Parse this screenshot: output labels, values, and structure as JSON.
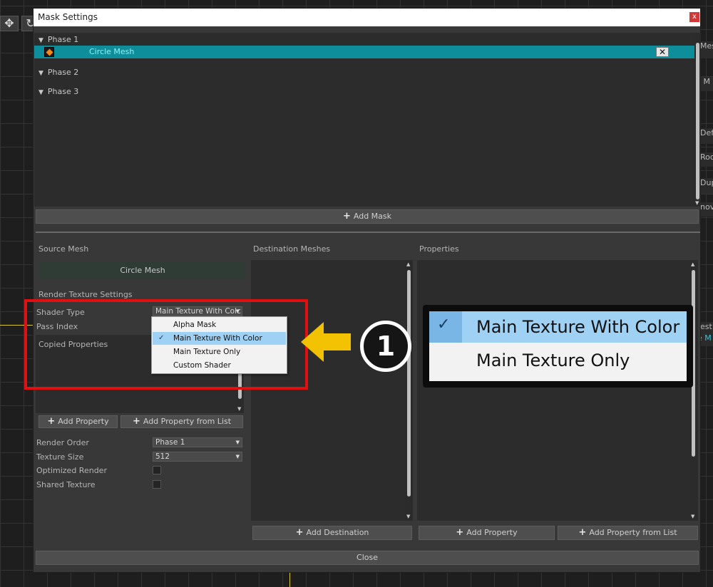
{
  "background": {
    "right_labels": [
      "Mes",
      "M",
      "Def",
      "Roo",
      "Dup",
      "nove",
      "est",
      "e M"
    ]
  },
  "dialog": {
    "title": "Mask Settings",
    "close_glyph": "x",
    "phases": [
      {
        "label": "Phase 1"
      },
      {
        "label": "Phase 2"
      },
      {
        "label": "Phase 3"
      }
    ],
    "mask_item": {
      "name": "Circle Mesh",
      "delete_glyph": "✕"
    },
    "add_mask_label": "Add Mask",
    "source": {
      "header": "Source Mesh",
      "mesh_name": "Circle Mesh",
      "render_texture_header": "Render Texture Settings",
      "shader_type_label": "Shader Type",
      "shader_type_value": "Main Texture With Colc",
      "pass_index_label": "Pass Index",
      "copied_properties_label": "Copied Properties",
      "add_property_label": "Add Property",
      "add_property_from_list_label": "Add Property from List",
      "render_order_label": "Render Order",
      "render_order_value": "Phase 1",
      "texture_size_label": "Texture Size",
      "texture_size_value": "512",
      "optimized_render_label": "Optimized Render",
      "shared_texture_label": "Shared Texture"
    },
    "destination": {
      "header": "Destination Meshes",
      "add_label": "Add Destination"
    },
    "properties": {
      "header": "Properties",
      "add_label": "Add Property",
      "add_from_list_label": "Add Property from List"
    },
    "close_label": "Close"
  },
  "shader_menu": {
    "options": [
      "Alpha Mask",
      "Main Texture With Color",
      "Main Texture Only",
      "Custom Shader"
    ],
    "selected": "Main Texture With Color",
    "check_glyph": "✓"
  },
  "annotation": {
    "step_number": "1",
    "zoom_options": [
      "Main Texture With Color",
      "Main Texture Only"
    ],
    "check_glyph": "✓",
    "colors": {
      "highlight": "#e01010",
      "arrow": "#f2c200",
      "selection": "#9fd1f5"
    }
  }
}
